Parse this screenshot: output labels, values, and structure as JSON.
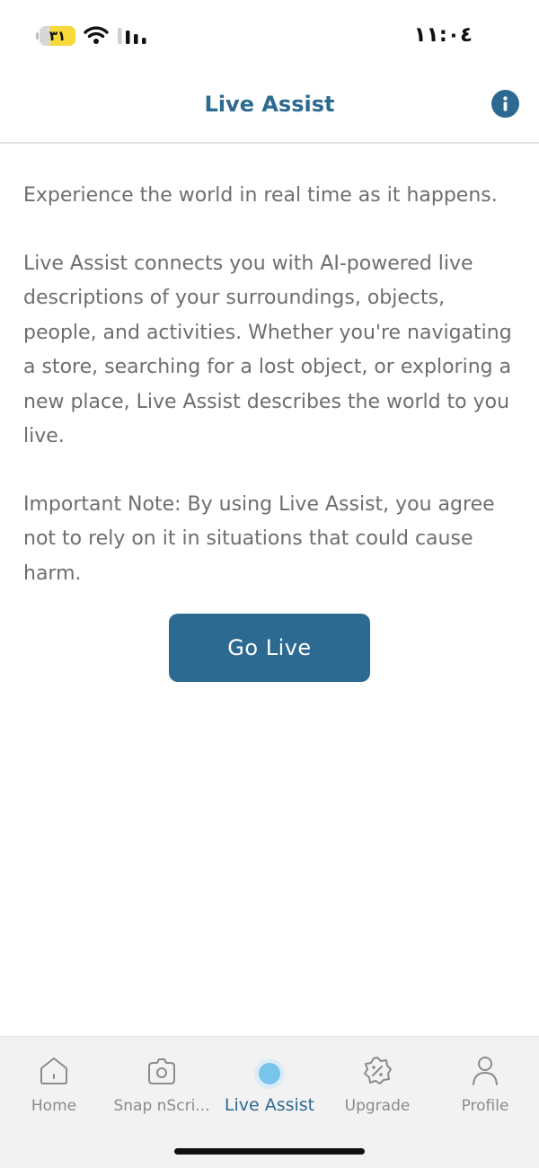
{
  "status_bar": {
    "battery_level": "٣١",
    "time": "١١:٠٤"
  },
  "header": {
    "title": "Live Assist"
  },
  "content": {
    "paragraphs": [
      "Experience the world in real time as it happens.",
      "Live Assist connects you with AI-powered live descriptions of your surroundings, objects, people, and activities. Whether you're navigating a store, searching for a lost object, or exploring a new place, Live Assist describes the world to you live.",
      "Important Note: By using Live Assist, you agree not to rely on it in situations that could cause harm."
    ],
    "go_live_label": "Go Live"
  },
  "tabs": [
    {
      "label": "Home",
      "icon": "home-icon"
    },
    {
      "label": "Snap nScri...",
      "icon": "camera-icon"
    },
    {
      "label": "Live Assist",
      "icon": "live-dot-icon",
      "active": true
    },
    {
      "label": "Upgrade",
      "icon": "discount-badge-icon"
    },
    {
      "label": "Profile",
      "icon": "person-icon"
    }
  ],
  "colors": {
    "accent": "#2d6a91",
    "body_text": "#6e6e6e",
    "tab_inactive": "#8b8b8b",
    "live_dot": "#79c4ec",
    "battery": "#f8d93a"
  }
}
